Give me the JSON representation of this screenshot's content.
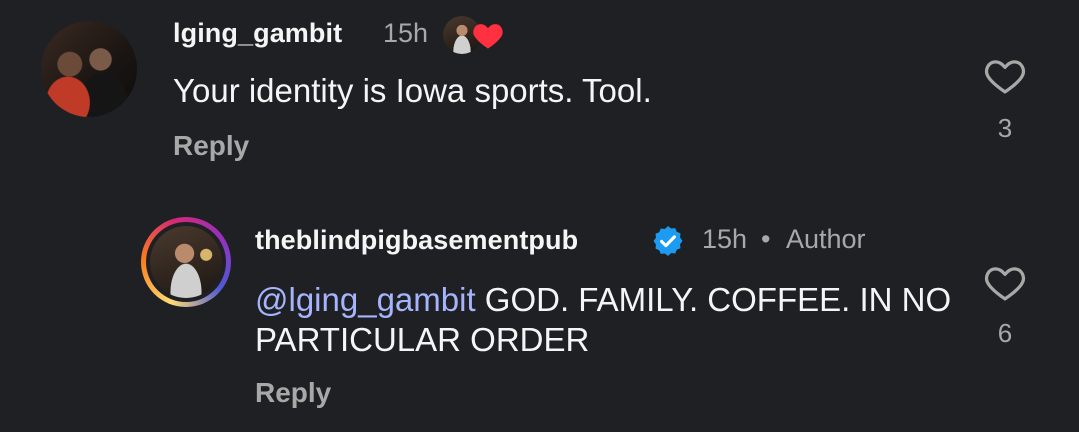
{
  "comments": [
    {
      "username": "lging_gambit",
      "time": "15h",
      "text": "Your identity is Iowa sports. Tool.",
      "reply_label": "Reply",
      "like_count": "3",
      "liked_by_author": true
    },
    {
      "username": "theblindpigbasementpub",
      "verified": true,
      "time": "15h",
      "separator": "•",
      "author_badge": "Author",
      "mention": "@lging_gambit",
      "text": " GOD. FAMILY. COFFEE. IN NO PARTICULAR ORDER",
      "reply_label": "Reply",
      "like_count": "6"
    }
  ],
  "colors": {
    "background": "#1f2023",
    "text": "#f5f5f5",
    "muted": "#a8a8a8",
    "mention": "#a5b4fc",
    "verified": "#1d9bf0",
    "heart_liked": "#ff3040"
  },
  "icons": {
    "like": "heart-outline-icon",
    "liked_by_author": "heart-filled-icon",
    "verified": "verified-badge-icon"
  }
}
